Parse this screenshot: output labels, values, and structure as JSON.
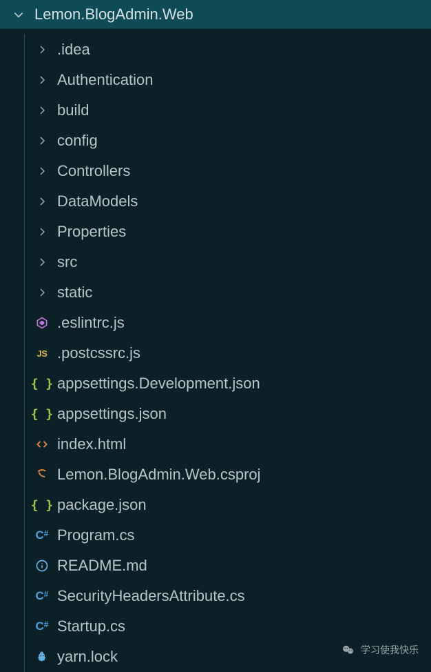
{
  "root": {
    "label": "Lemon.BlogAdmin.Web",
    "expanded": true
  },
  "items": [
    {
      "type": "folder",
      "label": ".idea",
      "iconName": "chevron-right-icon"
    },
    {
      "type": "folder",
      "label": "Authentication",
      "iconName": "chevron-right-icon"
    },
    {
      "type": "folder",
      "label": "build",
      "iconName": "chevron-right-icon"
    },
    {
      "type": "folder",
      "label": "config",
      "iconName": "chevron-right-icon"
    },
    {
      "type": "folder",
      "label": "Controllers",
      "iconName": "chevron-right-icon"
    },
    {
      "type": "folder",
      "label": "DataModels",
      "iconName": "chevron-right-icon"
    },
    {
      "type": "folder",
      "label": "Properties",
      "iconName": "chevron-right-icon"
    },
    {
      "type": "folder",
      "label": "src",
      "iconName": "chevron-right-icon"
    },
    {
      "type": "folder",
      "label": "static",
      "iconName": "chevron-right-icon"
    },
    {
      "type": "file",
      "label": ".eslintrc.js",
      "iconName": "eslint-icon"
    },
    {
      "type": "file",
      "label": ".postcssrc.js",
      "iconName": "js-icon"
    },
    {
      "type": "file",
      "label": "appsettings.Development.json",
      "iconName": "json-icon"
    },
    {
      "type": "file",
      "label": "appsettings.json",
      "iconName": "json-icon"
    },
    {
      "type": "file",
      "label": "index.html",
      "iconName": "html-icon"
    },
    {
      "type": "file",
      "label": "Lemon.BlogAdmin.Web.csproj",
      "iconName": "csproj-icon"
    },
    {
      "type": "file",
      "label": "package.json",
      "iconName": "json-icon"
    },
    {
      "type": "file",
      "label": "Program.cs",
      "iconName": "csharp-icon"
    },
    {
      "type": "file",
      "label": "README.md",
      "iconName": "info-icon"
    },
    {
      "type": "file",
      "label": "SecurityHeadersAttribute.cs",
      "iconName": "csharp-icon"
    },
    {
      "type": "file",
      "label": "Startup.cs",
      "iconName": "csharp-icon"
    },
    {
      "type": "file",
      "label": "yarn.lock",
      "iconName": "yarn-icon"
    }
  ],
  "watermark": {
    "text": "学习使我快乐"
  },
  "iconColors": {
    "chevron-right-icon": "#8a9ba3",
    "eslint-icon": "#b877d9",
    "js-icon": "#d4b84a",
    "json-icon": "#a6c84a",
    "html-icon": "#e08844",
    "csproj-icon": "#e08844",
    "csharp-icon": "#4aa0e0",
    "info-icon": "#6ab8e8",
    "yarn-icon": "#6ab8e8"
  }
}
